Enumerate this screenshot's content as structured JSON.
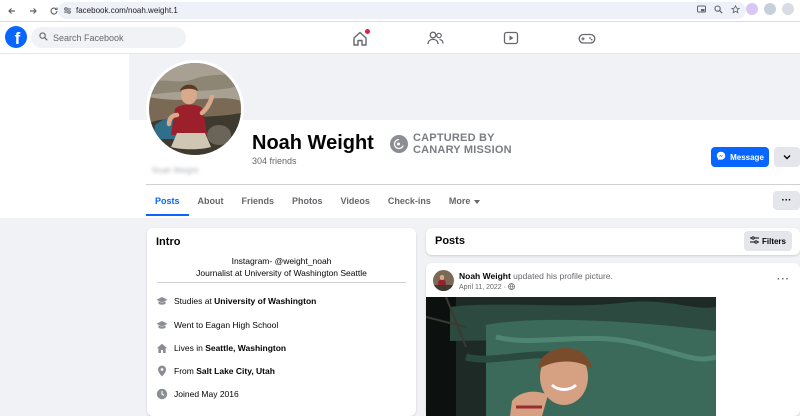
{
  "browser": {
    "url": "facebook.com/noah.weight.1"
  },
  "fb": {
    "search_placeholder": "Search Facebook",
    "nav_icons": [
      "home-icon",
      "friends-icon",
      "watch-icon",
      "gaming-icon"
    ]
  },
  "profile": {
    "name": "Noah Weight",
    "friends": "304 friends",
    "blurred_text": "Noah Weight",
    "watermark_line1": "CAPTURED BY",
    "watermark_line2": "CANARY MISSION",
    "message_button": "Message",
    "tabs": [
      "Posts",
      "About",
      "Friends",
      "Photos",
      "Videos",
      "Check-ins",
      "More"
    ],
    "accent": "#0866ff"
  },
  "intro": {
    "title": "Intro",
    "bio_line1": "Instagram- @weight_noah",
    "bio_line2": "Journalist at University of Washington Seattle",
    "items": [
      {
        "icon": "graduation-cap-icon",
        "prefix": "Studies at ",
        "strong": "University of Washington"
      },
      {
        "icon": "graduation-cap-icon",
        "prefix": "Went to Eagan High School",
        "strong": ""
      },
      {
        "icon": "house-icon",
        "prefix": "Lives in ",
        "strong": "Seattle, Washington"
      },
      {
        "icon": "location-pin-icon",
        "prefix": "From ",
        "strong": "Salt Lake City, Utah"
      },
      {
        "icon": "clock-icon",
        "prefix": "Joined May 2016",
        "strong": ""
      }
    ]
  },
  "posts": {
    "title": "Posts",
    "filters_label": "Filters",
    "post_author": "Noah Weight",
    "post_action": " updated his profile picture.",
    "post_date": "April 11, 2022 ·"
  }
}
